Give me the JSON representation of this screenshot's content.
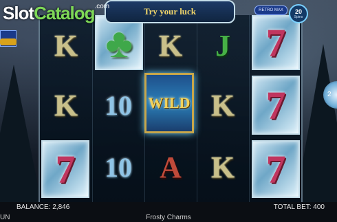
{
  "watermark": {
    "slot": "Slot",
    "catalog": "Catalog",
    "com": ".com"
  },
  "banner": {
    "text": "Try your luck"
  },
  "retro_mode": {
    "label": "RETRO MAX"
  },
  "free_spins": {
    "count": "20",
    "label": "Spins"
  },
  "side_orb": {
    "label": "2"
  },
  "reels": {
    "col1": [
      "K",
      "K",
      "7"
    ],
    "col2": [
      "clover",
      "10",
      "10"
    ],
    "col3": [
      "K",
      "WILD",
      "A"
    ],
    "col4": [
      "J",
      "K",
      "K"
    ],
    "col5": [
      "7",
      "7",
      "7"
    ]
  },
  "status": {
    "balance": "BALANCE: 2,846",
    "total_bet": "TOTAL BET: 400",
    "game_name": "Frosty Charms",
    "edge": "UN"
  }
}
